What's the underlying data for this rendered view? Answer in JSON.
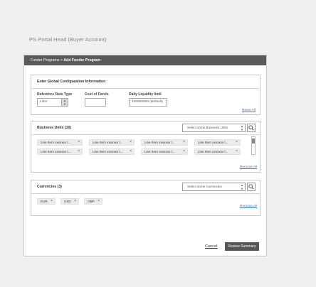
{
  "page": {
    "title": "PS Portal Head (Buyer Account)"
  },
  "header": {
    "breadcrumb_parent": "Funder Programs",
    "breadcrumb_sep": ">",
    "breadcrumb_current": "Add Funder Program"
  },
  "config": {
    "title": "Enter Global Configuration Information",
    "rate_type_label": "Reference Rate Type",
    "rate_type_value": "Libor",
    "cost_label": "Cost of Funds",
    "cost_value": "",
    "liquidity_label": "Daily Liquidity limit",
    "liquidity_value": "100000000 (Default)",
    "reset_label": "Reset All"
  },
  "business_units": {
    "title": "Business Units (10)",
    "select_placeholder": "Select some Business Units",
    "remove_all_label": "Remove All",
    "items": [
      "Line Item xxxxxxx l...",
      "Line Item xxxxxxx l...",
      "Line Item xxxxxxx l...",
      "Line Item xxxxxxx l...",
      "Line Item xxxxxxx l...",
      "Line Item xxxxxxx l...",
      "Line Item xxxxxxx l...",
      "Line Item xxxxxxx l..."
    ]
  },
  "currencies": {
    "title": "Currencies (3)",
    "select_placeholder": "Select some Currencies",
    "remove_all_label": "Remove All",
    "items": [
      "EUR",
      "USD",
      "GBP"
    ]
  },
  "footer": {
    "cancel_label": "Cancel",
    "submit_label": "Review Summary"
  },
  "icons": {
    "chip_remove": "×",
    "stepper": "▲▼"
  }
}
